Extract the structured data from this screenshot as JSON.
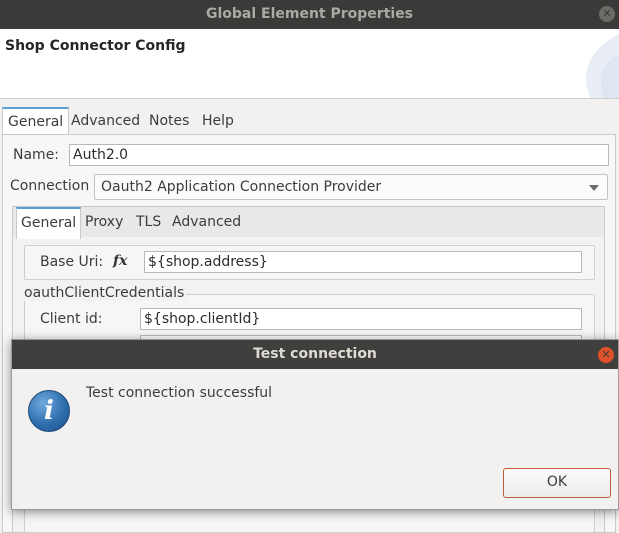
{
  "window": {
    "title": "Global Element Properties"
  },
  "header": {
    "title": "Shop Connector Config"
  },
  "tabs": [
    {
      "label": "General",
      "active": true
    },
    {
      "label": "Advanced"
    },
    {
      "label": "Notes"
    },
    {
      "label": "Help"
    }
  ],
  "form": {
    "name_label": "Name:",
    "name_value": "Auth2.0",
    "connection_label": "Connection",
    "connection_value": "Oauth2 Application Connection Provider"
  },
  "inner_tabs": [
    {
      "label": "General",
      "active": true
    },
    {
      "label": "Proxy"
    },
    {
      "label": "TLS"
    },
    {
      "label": "Advanced"
    }
  ],
  "general": {
    "base_uri_label": "Base Uri:",
    "base_uri_value": "${shop.address}",
    "fx_symbol": "fx",
    "credentials_group": "oauthClientCredentials",
    "client_id_label": "Client id:",
    "client_id_value": "${shop.clientId}"
  },
  "dialog": {
    "title": "Test connection",
    "message": "Test connection successful",
    "ok_label": "OK",
    "icon_glyph": "i",
    "icon": "info-icon",
    "close_icon": "close-icon"
  },
  "colors": {
    "titlebar": "#3a3a38",
    "tab_accent": "#5c9fd4",
    "dialog_close": "#e0502a",
    "ok_border": "#c35a3a"
  }
}
